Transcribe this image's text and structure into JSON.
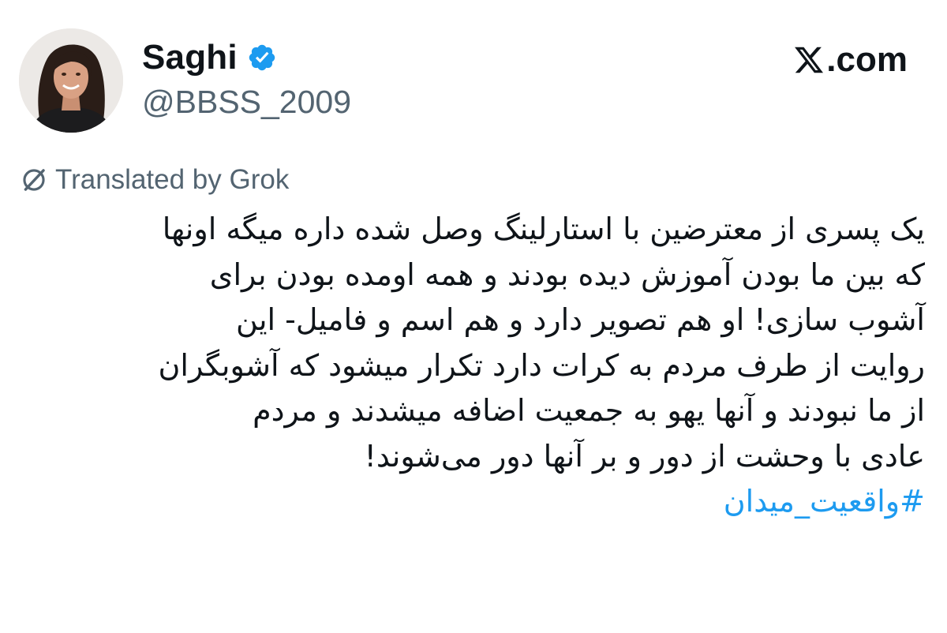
{
  "author": {
    "display_name": "Saghi",
    "handle": "@BBSS_2009",
    "verified": true,
    "verified_color": "#1d9bf0"
  },
  "brand": {
    "text": ".com",
    "icon": "x-logo-icon"
  },
  "translation": {
    "label": "Translated by Grok",
    "icon": "grok-icon"
  },
  "tweet": {
    "lines": [
      "یک پسری از معترضین با استارلینگ وصل شده داره میگه اونها",
      "که بین ما بودن آموزش دیده بودند و همه اومده بودن برای",
      "آشوب سازی! او هم تصویر دارد و هم اسم و فامیل- این",
      "روایت از طرف مردم به کرات دارد تکرار میشود که آشوبگران",
      "از ما نبودند و آنها یهو به جمعیت اضافه میشدند و مردم",
      "عادی با وحشت از دور و بر آنها دور می‌شوند!"
    ],
    "hashtag": "#واقعیت_میدان",
    "hashtag_color": "#1d9bf0"
  },
  "colors": {
    "text_primary": "#0f1419",
    "text_secondary": "#536471",
    "background": "#ffffff"
  }
}
